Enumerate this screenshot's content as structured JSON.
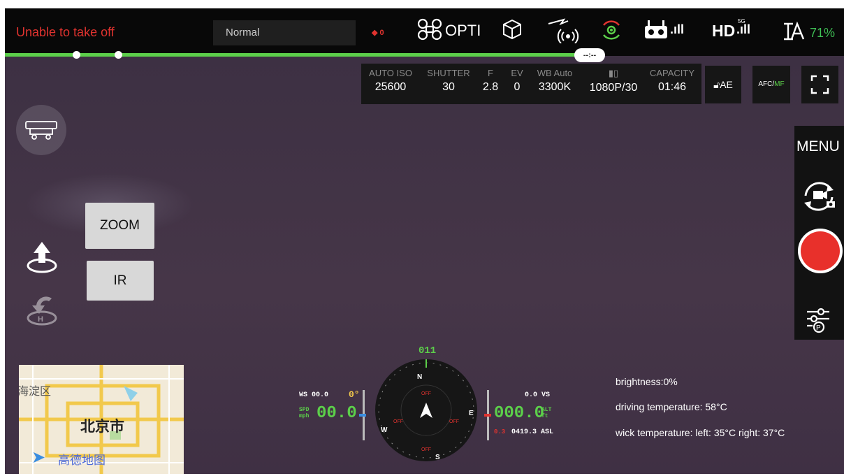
{
  "status": {
    "warning": "Unable to take off",
    "flight_mode": "Normal",
    "obstacle_count": "0",
    "vision_label": "OPTI",
    "rc_label": ".ıll",
    "hd_label": "HD",
    "hd_sub": "5G",
    "battery_percent": "71%",
    "time_pill": "--:--"
  },
  "camera": {
    "params": [
      {
        "label": "AUTO ISO",
        "value": "25600"
      },
      {
        "label": "SHUTTER",
        "value": "30"
      },
      {
        "label": "F",
        "value": "2.8"
      },
      {
        "label": "EV",
        "value": "0"
      },
      {
        "label": "WB Auto",
        "value": "3300K"
      },
      {
        "label": "",
        "value": "1080P/30"
      },
      {
        "label": "CAPACITY",
        "value": "01:46"
      }
    ],
    "ae_label": "AE",
    "afc_label": "AFC/",
    "mf_label": "MF"
  },
  "right_panel": {
    "menu_label": "MENU"
  },
  "left_panel": {
    "zoom_label": "ZOOM",
    "ir_label": "IR"
  },
  "map": {
    "district": "海淀区",
    "city": "北京市",
    "brand": "高德地图"
  },
  "telemetry": {
    "ws": "WS 00.0",
    "spd_unit_top": "SPD",
    "spd_unit_bottom": "mph",
    "speed": "00.0",
    "gimbal_angle": "0°",
    "heading": "011",
    "vs": "0.0 VS",
    "altitude": "000.0",
    "alt_unit_top": "ALT",
    "alt_unit_bottom": "ft",
    "asl": "0419.3 ASL",
    "dist_red": "0.3",
    "compass_n": "N",
    "compass_e": "E",
    "compass_s": "S",
    "compass_w": "W",
    "off": "OFF"
  },
  "info": {
    "brightness": "brightness:0%",
    "driving_temp": "driving temperature: 58°C",
    "wick_temp": "wick temperature: left: 35°C right: 37°C"
  },
  "colors": {
    "warning": "#e0332f",
    "accent_green": "#5ccf4a",
    "record_red": "#e8302b"
  }
}
